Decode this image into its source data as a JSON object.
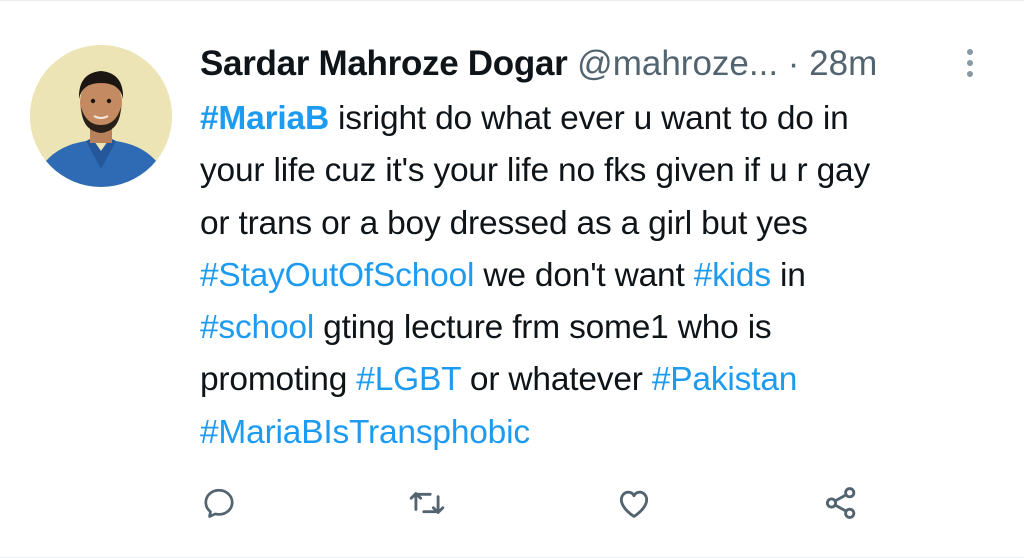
{
  "tweet": {
    "author": {
      "display_name": "Sardar Mahroze Dogar",
      "handle": "@mahroze...",
      "separator": "·",
      "time": "28m"
    },
    "lines": [
      [
        {
          "text": "#MariaB",
          "type": "hashtag-bold"
        },
        {
          "text": " isright do what ever u want to do in",
          "type": "text"
        }
      ],
      [
        {
          "text": "your life cuz it's your life no fks given if u r gay",
          "type": "text"
        }
      ],
      [
        {
          "text": "or trans or a boy dressed as a girl but yes",
          "type": "text"
        }
      ],
      [
        {
          "text": "#StayOutOfSchool",
          "type": "hashtag"
        },
        {
          "text": " we don't want ",
          "type": "text"
        },
        {
          "text": "#kids",
          "type": "hashtag"
        },
        {
          "text": " in",
          "type": "text"
        }
      ],
      [
        {
          "text": "#school",
          "type": "hashtag"
        },
        {
          "text": " gting lecture frm some1 who is",
          "type": "text"
        }
      ],
      [
        {
          "text": "promoting ",
          "type": "text"
        },
        {
          "text": "#LGBT",
          "type": "hashtag"
        },
        {
          "text": " or whatever ",
          "type": "text"
        },
        {
          "text": "#Pakistan",
          "type": "hashtag"
        }
      ],
      [
        {
          "text": "#MariaBIsTransphobic",
          "type": "hashtag"
        }
      ]
    ]
  },
  "actions": [
    {
      "name": "reply-icon"
    },
    {
      "name": "retweet-icon"
    },
    {
      "name": "like-icon"
    },
    {
      "name": "share-icon"
    }
  ],
  "colors": {
    "hashtag": "#1d9bf0",
    "text": "#0f1419",
    "muted": "#536471",
    "icon": "#536471"
  }
}
